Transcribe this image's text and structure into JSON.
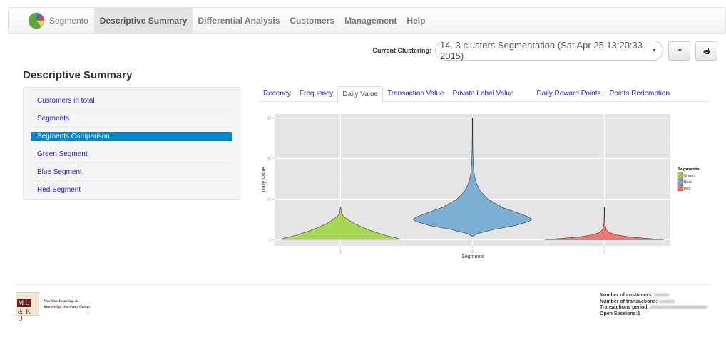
{
  "navbar": {
    "brand": "Segmento",
    "items": [
      {
        "label": "Descriptive Summary",
        "active": true
      },
      {
        "label": "Differential Analysis",
        "active": false
      },
      {
        "label": "Customers",
        "active": false
      },
      {
        "label": "Management",
        "active": false
      },
      {
        "label": "Help",
        "active": false
      }
    ]
  },
  "clustering": {
    "label": "Current Clustering:",
    "selected": "14. 3 clusters Segmentation (Sat Apr 25 13:20:33 2015)",
    "more_button": "•••",
    "print_icon": "print-icon"
  },
  "page_title": "Descriptive Summary",
  "sidebar": {
    "items": [
      {
        "label": "Customers in total",
        "active": false
      },
      {
        "label": "Segments",
        "active": false
      },
      {
        "label": "Segments Comparison",
        "active": true
      },
      {
        "label": "Green Segment",
        "active": false
      },
      {
        "label": "Blue Segment",
        "active": false
      },
      {
        "label": "Red Segment",
        "active": false
      }
    ]
  },
  "tabs": [
    {
      "label": "Recency",
      "active": false
    },
    {
      "label": "Frequency",
      "active": false
    },
    {
      "label": "Daily Value",
      "active": true
    },
    {
      "label": "Transaction Value",
      "active": false
    },
    {
      "label": "Private Label Value",
      "active": false
    },
    {
      "label": "Daily Reward Points",
      "active": false
    },
    {
      "label": "Points Redemption",
      "active": false
    }
  ],
  "chart_data": {
    "type": "violin",
    "title": "",
    "xlabel": "Segments",
    "ylabel": "Daily Value",
    "categories": [
      "1",
      "2",
      "3"
    ],
    "ylim": [
      -1.5,
      31
    ],
    "yticks": [
      0,
      10,
      20,
      30
    ],
    "grid": true,
    "legend": {
      "title": "Segments",
      "position": "right",
      "entries": [
        "Green",
        "Blue",
        "Red"
      ]
    },
    "series": [
      {
        "name": "Green",
        "category": "1",
        "color": "#a6d854",
        "min": 0.1,
        "max": 8,
        "mode": 0.3,
        "profile": [
          [
            0.1,
            1.0
          ],
          [
            0.4,
            0.95
          ],
          [
            1,
            0.78
          ],
          [
            2,
            0.56
          ],
          [
            3,
            0.38
          ],
          [
            4,
            0.23
          ],
          [
            5,
            0.12
          ],
          [
            5.8,
            0.05
          ],
          [
            6.5,
            0.015
          ],
          [
            8,
            0.003
          ]
        ]
      },
      {
        "name": "Blue",
        "category": "2",
        "color": "#7bafd4",
        "min": 0.8,
        "max": 30,
        "mode": 5,
        "profile": [
          [
            0.8,
            0.005
          ],
          [
            1.5,
            0.08
          ],
          [
            2.5,
            0.35
          ],
          [
            3.5,
            0.72
          ],
          [
            4.5,
            0.95
          ],
          [
            5,
            1.0
          ],
          [
            5.6,
            0.95
          ],
          [
            6.5,
            0.78
          ],
          [
            8,
            0.5
          ],
          [
            10,
            0.26
          ],
          [
            12,
            0.13
          ],
          [
            14,
            0.065
          ],
          [
            16,
            0.03
          ],
          [
            19,
            0.012
          ],
          [
            22,
            0.006
          ],
          [
            25,
            0.004
          ],
          [
            30,
            0.002
          ]
        ]
      },
      {
        "name": "Red",
        "category": "3",
        "color": "#f8766d",
        "min": 0.05,
        "max": 8,
        "mode": 0.1,
        "profile": [
          [
            0.05,
            1.0
          ],
          [
            0.3,
            0.75
          ],
          [
            0.7,
            0.42
          ],
          [
            1.2,
            0.2
          ],
          [
            1.8,
            0.08
          ],
          [
            2.5,
            0.03
          ],
          [
            4,
            0.008
          ],
          [
            6,
            0.003
          ],
          [
            8,
            0.002
          ]
        ]
      }
    ]
  },
  "footer": {
    "logo_ml": "ML",
    "logo_kd": "& K D",
    "group_line1": "Machine Learning &",
    "group_line2": "Knowledge Discovery Group",
    "stats": [
      {
        "label": "Number of customers:",
        "value_hidden": true
      },
      {
        "label": "Number of transactions:",
        "value_hidden": true
      },
      {
        "label": "Transactions period:",
        "value_hidden": true
      },
      {
        "label": "Open Sessions:1",
        "value_hidden": false
      }
    ]
  }
}
